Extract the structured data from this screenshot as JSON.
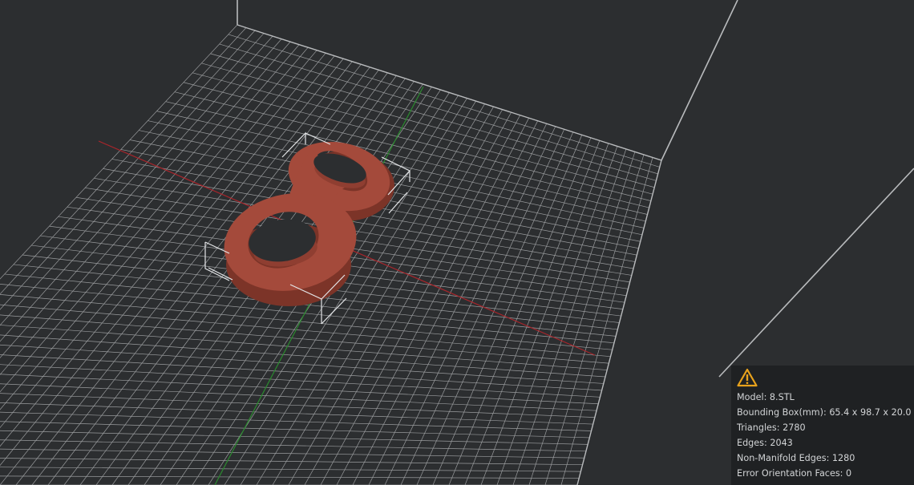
{
  "colors": {
    "background": "#2c2e30",
    "grid": "#9a9c9e",
    "walls": "#b9bbbd",
    "x_axis": "#a8252b",
    "y_axis": "#2b8a2f",
    "model": "#a44a3b",
    "warning": "#e8a21c",
    "panel": "#1f2123"
  },
  "icons": {
    "warning": "warning-triangle-icon"
  },
  "info": {
    "model_label": "Model:",
    "model_value": "8.STL",
    "bbox_label": "Bounding Box(mm):",
    "bbox_value": "65.4 x 98.7 x 20.0",
    "triangles_label": "Triangles:",
    "triangles_value": "2780",
    "edges_label": "Edges:",
    "edges_value": "2043",
    "non_manifold_label": "Non-Manifold Edges:",
    "non_manifold_value": "1280",
    "error_orientation_label": "Error Orientation Faces:",
    "error_orientation_value": "0"
  }
}
